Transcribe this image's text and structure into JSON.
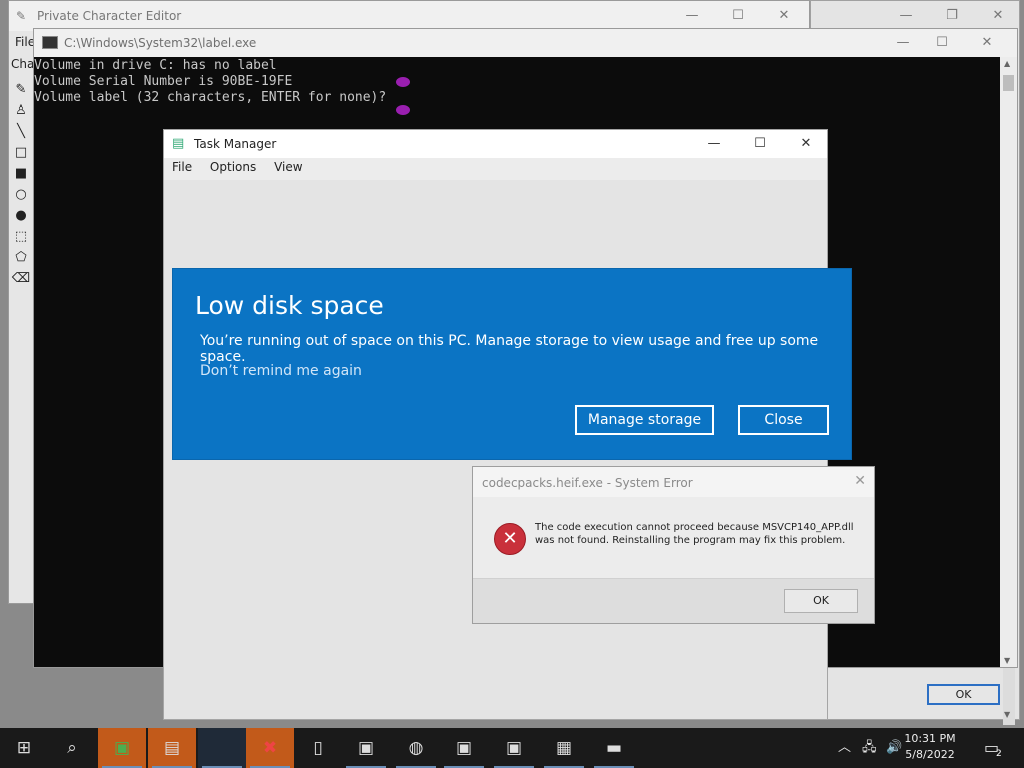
{
  "pce": {
    "title": "Private Character Editor",
    "menu_file": "File",
    "menu_char": "Cha"
  },
  "console": {
    "title": "C:\\Windows\\System32\\label.exe",
    "lines": [
      "Volume in drive C: has no label",
      "Volume Serial Number is 90BE-19FE",
      "Volume label (32 characters, ENTER for none)?"
    ]
  },
  "taskmgr": {
    "title": "Task Manager",
    "menu": [
      "File",
      "Options",
      "View"
    ]
  },
  "toast": {
    "heading": "Low disk space",
    "body": "You’re running out of space on this PC. Manage storage to view usage and free up some space.",
    "link": "Don’t remind me again",
    "manage_label": "Manage storage",
    "close_label": "Close"
  },
  "syserr": {
    "title": "codecpacks.heif.exe - System Error",
    "message": "The code execution cannot proceed because MSVCP140_APP.dll was not found. Reinstalling the program may fix this problem.",
    "ok_label": "OK"
  },
  "bg_ok_label": "OK",
  "taskbar": {
    "time": "10:31 PM",
    "date": "5/8/2022",
    "notifications": "2"
  },
  "colors": {
    "toast_bg": "#0b74c4",
    "error_icon": "#c9303b",
    "taskbar": "#1a1a1a"
  }
}
